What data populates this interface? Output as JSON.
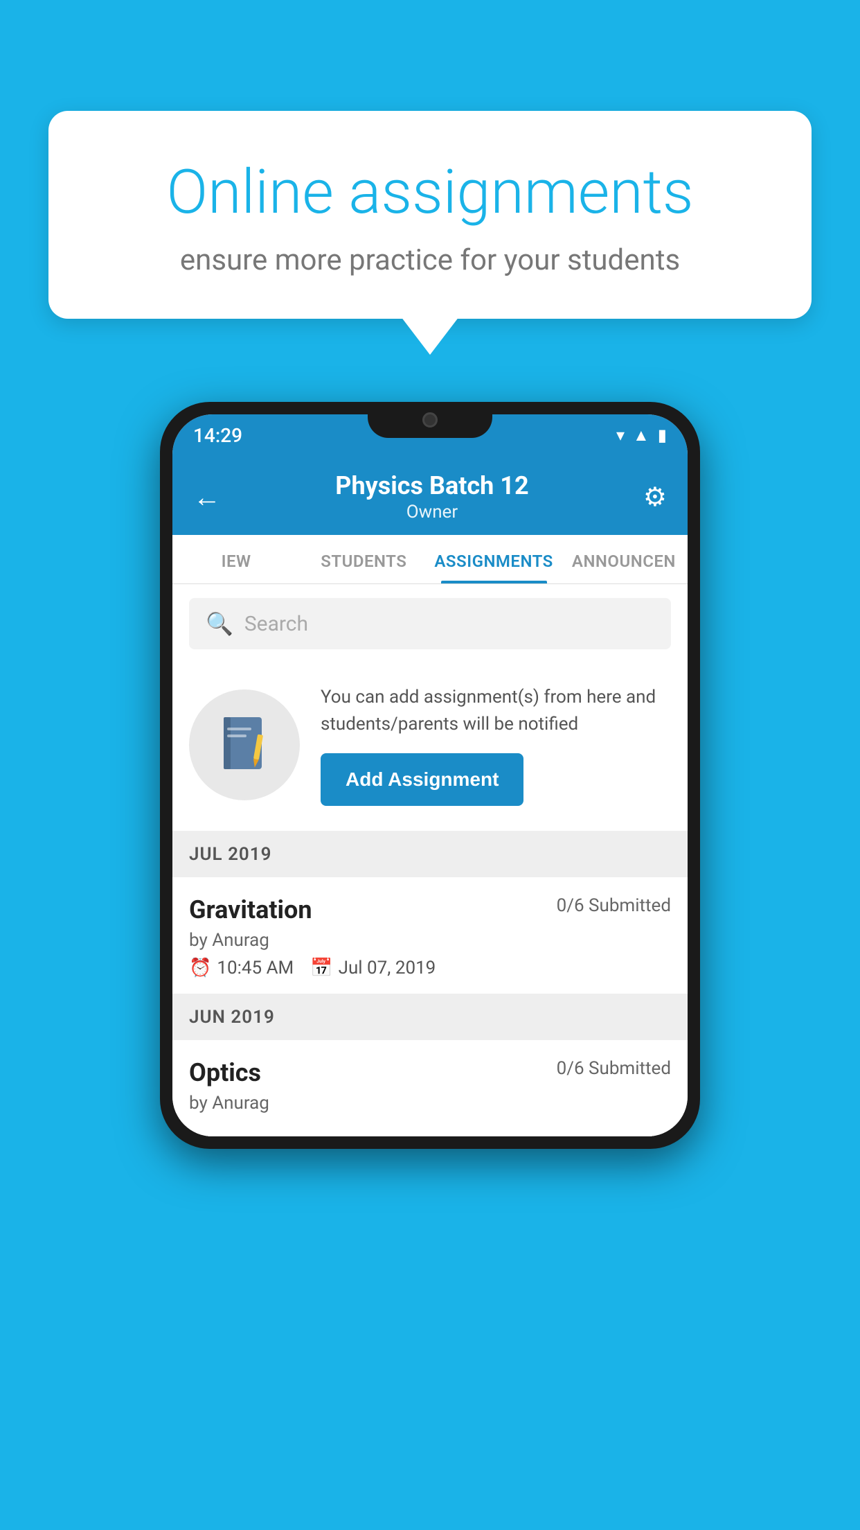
{
  "background_color": "#1ab3e8",
  "bubble": {
    "title": "Online assignments",
    "subtitle": "ensure more practice for your students"
  },
  "status_bar": {
    "time": "14:29",
    "icons": [
      "wifi",
      "signal",
      "battery"
    ]
  },
  "header": {
    "title": "Physics Batch 12",
    "subtitle": "Owner"
  },
  "tabs": [
    {
      "label": "IEW",
      "active": false
    },
    {
      "label": "STUDENTS",
      "active": false
    },
    {
      "label": "ASSIGNMENTS",
      "active": true
    },
    {
      "label": "ANNOUNCER",
      "active": false
    }
  ],
  "search": {
    "placeholder": "Search"
  },
  "info_card": {
    "description": "You can add assignment(s) from here and students/parents will be notified",
    "button_label": "Add Assignment"
  },
  "sections": [
    {
      "label": "JUL 2019",
      "assignments": [
        {
          "name": "Gravitation",
          "submitted": "0/6 Submitted",
          "by": "by Anurag",
          "time": "10:45 AM",
          "date": "Jul 07, 2019"
        }
      ]
    },
    {
      "label": "JUN 2019",
      "assignments": [
        {
          "name": "Optics",
          "submitted": "0/6 Submitted",
          "by": "by Anurag",
          "time": "",
          "date": ""
        }
      ]
    }
  ]
}
